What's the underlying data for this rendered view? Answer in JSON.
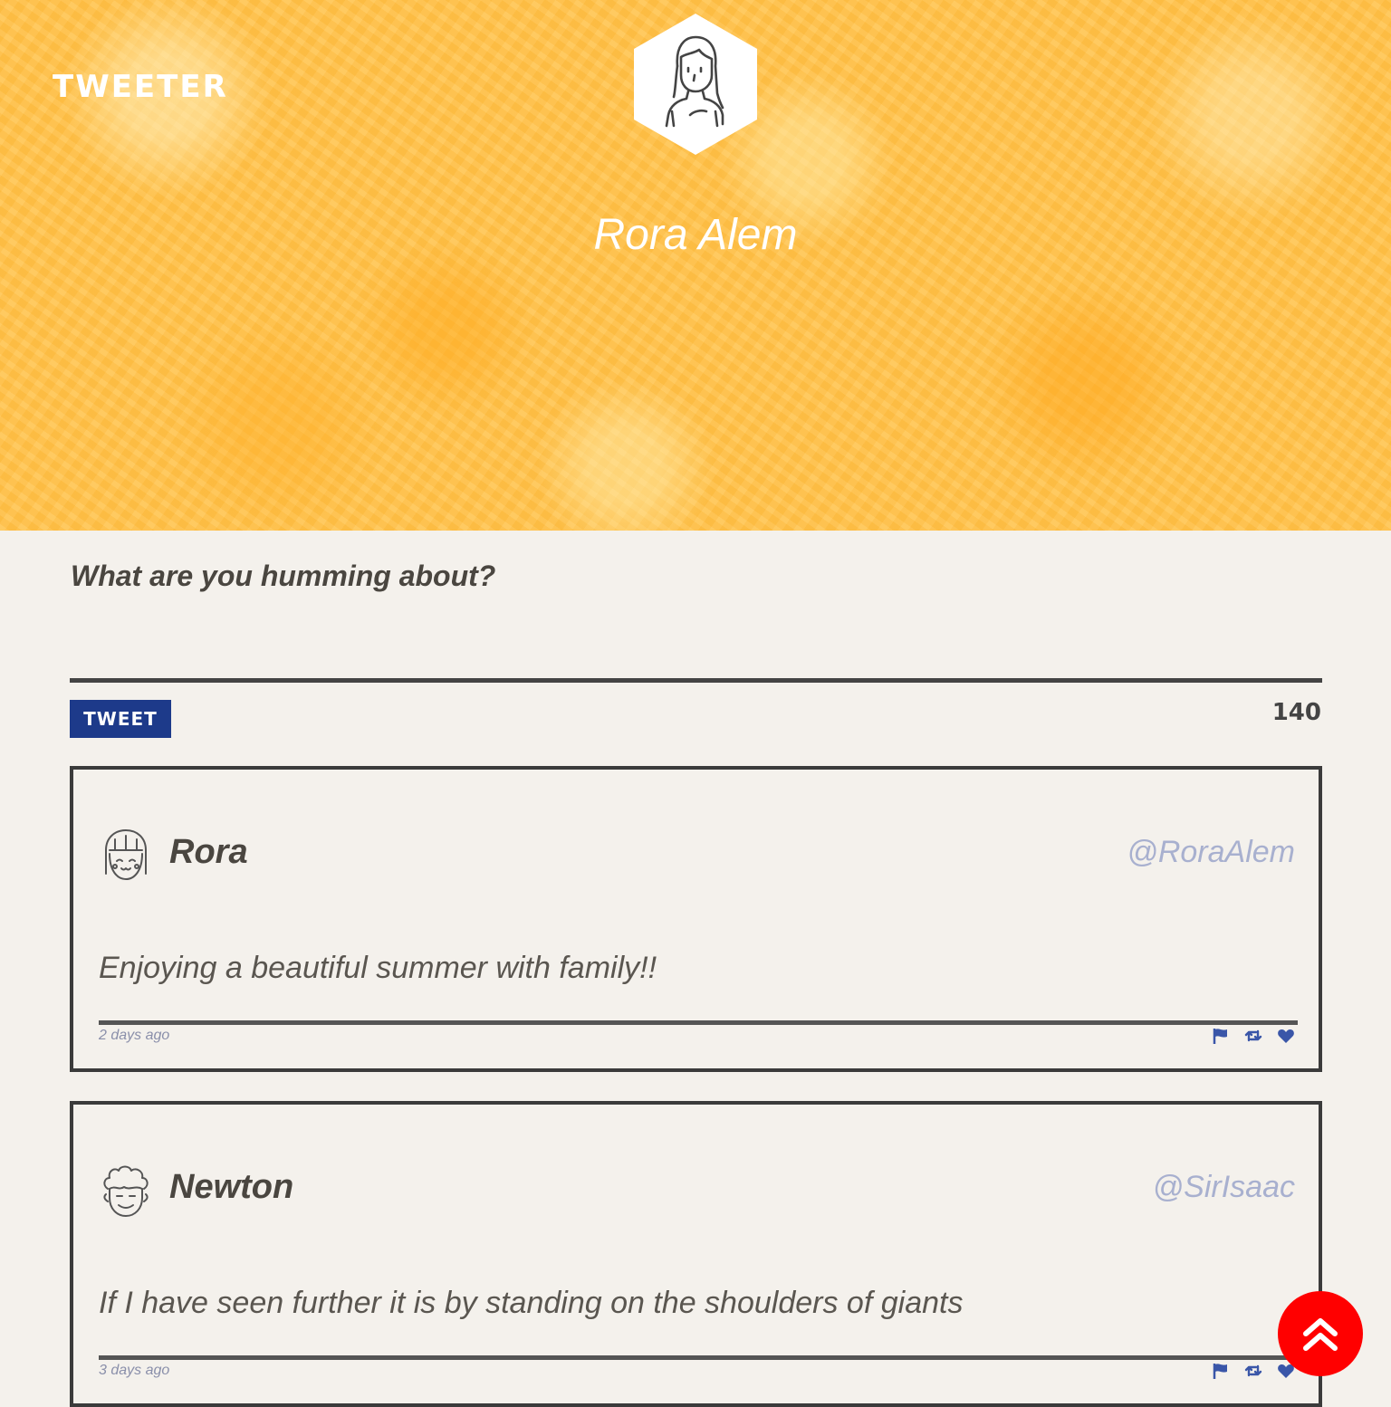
{
  "header": {
    "brand": "TWEETER",
    "profile_name": "Rora Alem"
  },
  "compose": {
    "prompt": "What are you humming about?",
    "input_value": "",
    "tweet_button": "TWEET",
    "char_counter": "140"
  },
  "tweets": [
    {
      "name": "Rora",
      "handle": "@RoraAlem",
      "text": "Enjoying a beautiful summer with family!!",
      "time_ago": "2 days ago",
      "avatar_icon": "girl-face-icon"
    },
    {
      "name": "Newton",
      "handle": "@SirIsaac",
      "text": "If I have seen further it is by standing on the shoulders of giants",
      "time_ago": "3 days ago",
      "avatar_icon": "curly-hair-face-icon"
    }
  ],
  "actions": [
    "flag-icon",
    "retweet-icon",
    "heart-icon"
  ],
  "colors": {
    "header_bg": "#ffc24a",
    "page_bg": "#f4f1ec",
    "tweet_button_bg": "#1d3a8a",
    "handle": "#a8b0cf",
    "action_icons": "#3a56a8",
    "scroll_top_bg": "#ff0000"
  }
}
